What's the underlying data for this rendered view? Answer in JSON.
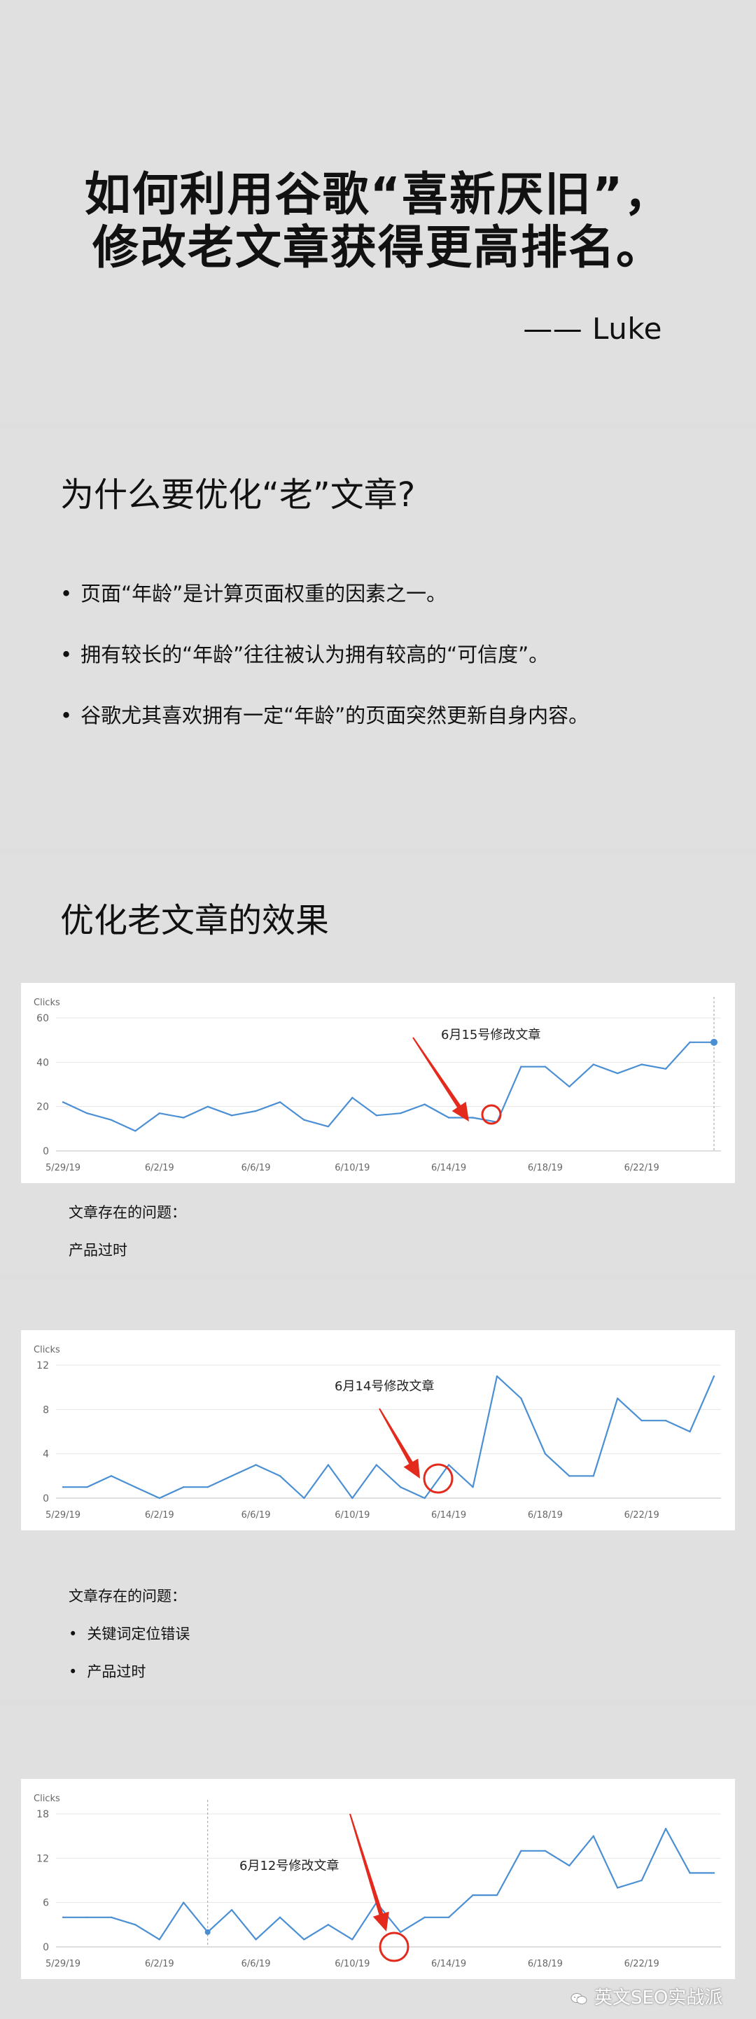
{
  "header": {
    "title_line_1": "如何利用谷歌“喜新厌旧”，",
    "title_line_2": "修改老文章获得更高排名。",
    "author": "—— Luke"
  },
  "why_section": {
    "title": "为什么要优化“老”文章?",
    "bullets": [
      "页面“年龄”是计算页面权重的因素之一。",
      "拥有较长的“年龄”往往被认为拥有较高的“可信度”。",
      "谷歌尤其喜欢拥有一定“年龄”的页面突然更新自身内容。"
    ]
  },
  "effect_section": {
    "title": "优化老文章的效果"
  },
  "charts": [
    {
      "label": "Clicks",
      "annotation": "6月15号修改文章",
      "problem_label": "文章存在的问题：",
      "problems": [
        "产品过时"
      ]
    },
    {
      "label": "Clicks",
      "annotation": "6月14号修改文章",
      "problem_label": "文章存在的问题：",
      "problems": [
        "关键词定位错误",
        "产品过时"
      ]
    },
    {
      "label": "Clicks",
      "annotation": "6月12号修改文章"
    }
  ],
  "chart_data": [
    {
      "type": "line",
      "ylabel": "Clicks",
      "ylim": [
        0,
        60
      ],
      "yticks": [
        0,
        20,
        40,
        60
      ],
      "xtick_labels": [
        "5/29/19",
        "6/2/19",
        "6/6/19",
        "6/10/19",
        "6/14/19",
        "6/18/19",
        "6/22/19"
      ],
      "x": [
        "5/29/19",
        "5/30/19",
        "5/31/19",
        "6/1/19",
        "6/2/19",
        "6/3/19",
        "6/4/19",
        "6/5/19",
        "6/6/19",
        "6/7/19",
        "6/8/19",
        "6/9/19",
        "6/10/19",
        "6/11/19",
        "6/12/19",
        "6/13/19",
        "6/14/19",
        "6/15/19",
        "6/16/19",
        "6/17/19",
        "6/18/19",
        "6/19/19",
        "6/20/19",
        "6/21/19",
        "6/22/19",
        "6/23/19",
        "6/24/19",
        "6/25/19"
      ],
      "series": [
        {
          "color": "#4a8fd3",
          "values": [
            22,
            17,
            14,
            9,
            17,
            15,
            20,
            16,
            18,
            22,
            14,
            11,
            24,
            16,
            17,
            21,
            15,
            15,
            13,
            38,
            38,
            29,
            39,
            35,
            39,
            37,
            49,
            49
          ]
        }
      ],
      "annotation": "6月15号修改文章",
      "highlight_x": "6/16/19",
      "grid": true
    },
    {
      "type": "line",
      "ylabel": "Clicks",
      "ylim": [
        0,
        12
      ],
      "yticks": [
        0,
        4,
        8,
        12
      ],
      "xtick_labels": [
        "5/29/19",
        "6/2/19",
        "6/6/19",
        "6/10/19",
        "6/14/19",
        "6/18/19",
        "6/22/19"
      ],
      "x": [
        "5/29/19",
        "5/30/19",
        "5/31/19",
        "6/1/19",
        "6/2/19",
        "6/3/19",
        "6/4/19",
        "6/5/19",
        "6/6/19",
        "6/7/19",
        "6/8/19",
        "6/9/19",
        "6/10/19",
        "6/11/19",
        "6/12/19",
        "6/13/19",
        "6/14/19",
        "6/15/19",
        "6/16/19",
        "6/17/19",
        "6/18/19",
        "6/19/19",
        "6/20/19",
        "6/21/19",
        "6/22/19",
        "6/23/19",
        "6/24/19",
        "6/25/19"
      ],
      "series": [
        {
          "color": "#4a8fd3",
          "values": [
            1,
            1,
            2,
            1,
            0,
            1,
            1,
            2,
            3,
            2,
            0,
            3,
            0,
            3,
            1,
            0,
            3,
            1,
            11,
            9,
            4,
            2,
            2,
            9,
            7,
            7,
            6,
            11
          ]
        }
      ],
      "annotation": "6月14号修改文章",
      "highlight_x": "6/14/19",
      "grid": true
    },
    {
      "type": "line",
      "ylabel": "Clicks",
      "ylim": [
        0,
        18
      ],
      "yticks": [
        0,
        6,
        12,
        18
      ],
      "xtick_labels": [
        "5/29/19",
        "6/2/19",
        "6/6/19",
        "6/10/19",
        "6/14/19",
        "6/18/19",
        "6/22/19"
      ],
      "x": [
        "5/29/19",
        "5/30/19",
        "5/31/19",
        "6/1/19",
        "6/2/19",
        "6/3/19",
        "6/4/19",
        "6/5/19",
        "6/6/19",
        "6/7/19",
        "6/8/19",
        "6/9/19",
        "6/10/19",
        "6/11/19",
        "6/12/19",
        "6/13/19",
        "6/14/19",
        "6/15/19",
        "6/16/19",
        "6/17/19",
        "6/18/19",
        "6/19/19",
        "6/20/19",
        "6/21/19",
        "6/22/19",
        "6/23/19",
        "6/24/19",
        "6/25/19"
      ],
      "series": [
        {
          "color": "#4a8fd3",
          "values": [
            4,
            4,
            4,
            3,
            1,
            6,
            2,
            5,
            1,
            4,
            1,
            3,
            1,
            6,
            2,
            4,
            4,
            7,
            7,
            13,
            13,
            11,
            15,
            8,
            9,
            16,
            10,
            10
          ]
        }
      ],
      "annotation": "6月12号修改文章",
      "highlight_x": "6/12/19",
      "grid": true
    }
  ],
  "watermark": {
    "text": "英文SEO实战派",
    "icon": "wechat-icon"
  }
}
